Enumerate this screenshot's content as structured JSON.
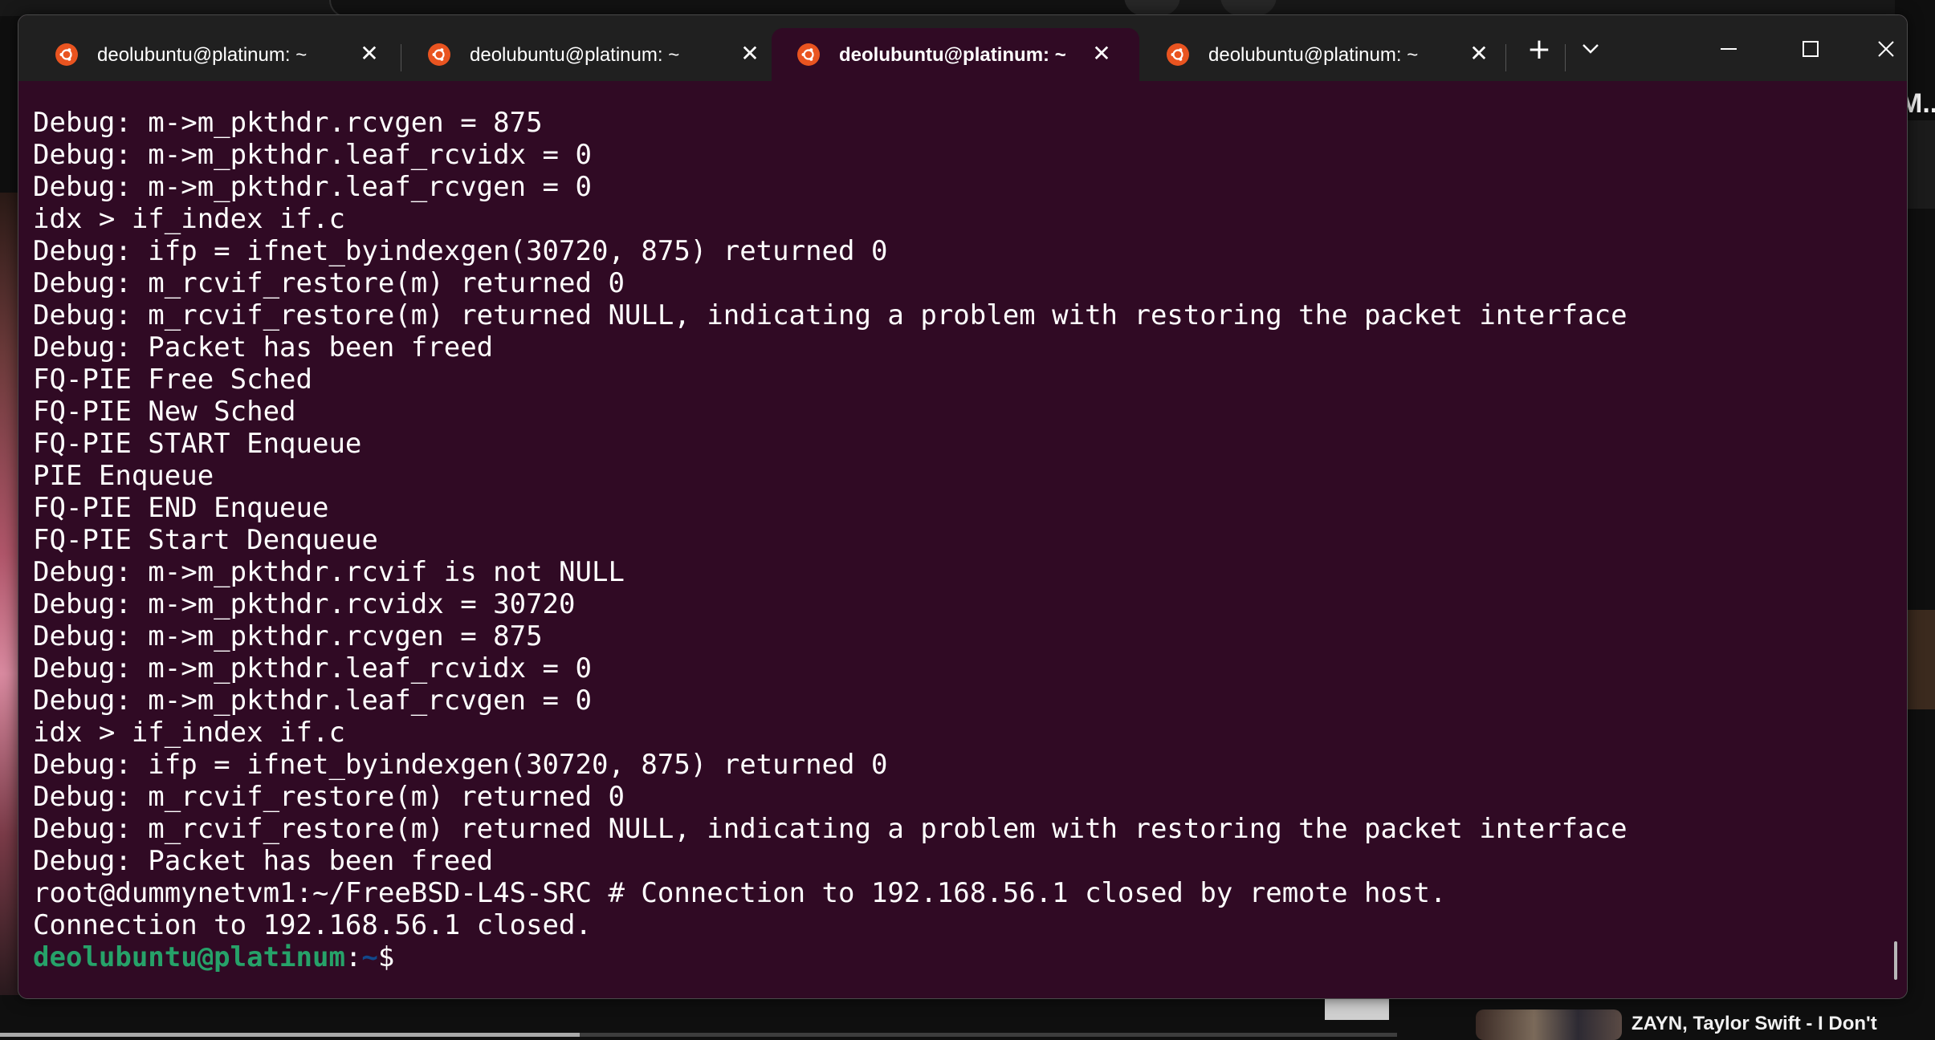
{
  "background": {
    "right_partial_text": "M...",
    "video_title": "ZAYN, Taylor Swift - I Don't",
    "progress": 0.415
  },
  "window": {
    "tabs": [
      {
        "label": "deolubuntu@platinum: ~",
        "active": false
      },
      {
        "label": "deolubuntu@platinum: ~",
        "active": false
      },
      {
        "label": "deolubuntu@platinum: ~",
        "active": true
      },
      {
        "label": "deolubuntu@platinum: ~",
        "active": false
      }
    ],
    "close_glyph": "✕",
    "new_tab_glyph": "+",
    "dropdown_glyph": "⌄",
    "minimize_glyph": "—",
    "maximize_glyph": "☐",
    "close_window_glyph": "✕"
  },
  "terminal": {
    "lines": [
      "Debug: m->m_pkthdr.rcvgen = 875",
      "Debug: m->m_pkthdr.leaf_rcvidx = 0",
      "Debug: m->m_pkthdr.leaf_rcvgen = 0",
      "idx > if_index if.c",
      "Debug: ifp = ifnet_byindexgen(30720, 875) returned 0",
      "Debug: m_rcvif_restore(m) returned 0",
      "Debug: m_rcvif_restore(m) returned NULL, indicating a problem with restoring the packet interface",
      "Debug: Packet has been freed",
      "FQ-PIE Free Sched",
      "FQ-PIE New Sched",
      "FQ-PIE START Enqueue",
      "PIE Enqueue",
      "FQ-PIE END Enqueue",
      "FQ-PIE Start Denqueue",
      "Debug: m->m_pkthdr.rcvif is not NULL",
      "Debug: m->m_pkthdr.rcvidx = 30720",
      "Debug: m->m_pkthdr.rcvgen = 875",
      "Debug: m->m_pkthdr.leaf_rcvidx = 0",
      "Debug: m->m_pkthdr.leaf_rcvgen = 0",
      "idx > if_index if.c",
      "Debug: ifp = ifnet_byindexgen(30720, 875) returned 0",
      "Debug: m_rcvif_restore(m) returned 0",
      "Debug: m_rcvif_restore(m) returned NULL, indicating a problem with restoring the packet interface",
      "Debug: Packet has been freed",
      "root@dummynetvm1:~/FreeBSD-L4S-SRC # Connection to 192.168.56.1 closed by remote host.",
      "Connection to 192.168.56.1 closed."
    ],
    "prompt": {
      "user_host": "deolubuntu@platinum",
      "colon": ":",
      "path": "~",
      "symbol": "$"
    },
    "colors": {
      "background": "#300a24",
      "text": "#ffffff",
      "prompt_user": "#26a269",
      "prompt_path": "#12488b",
      "accent_ubuntu": "#e95420"
    }
  }
}
